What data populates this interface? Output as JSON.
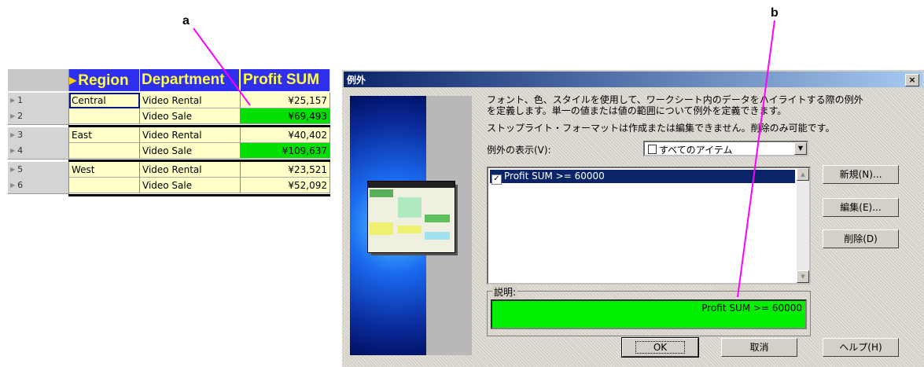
{
  "callouts": {
    "a": "a",
    "b": "b"
  },
  "grid": {
    "headers": [
      "Region",
      "Department",
      "Profit SUM"
    ],
    "rows": [
      {
        "num": "1",
        "region": "Central",
        "department": "Video Rental",
        "profit": "¥25,157",
        "highlight": false
      },
      {
        "num": "2",
        "region": "",
        "department": "Video Sale",
        "profit": "¥69,493",
        "highlight": true
      },
      {
        "num": "3",
        "region": "East",
        "department": "Video Rental",
        "profit": "¥40,402",
        "highlight": false
      },
      {
        "num": "4",
        "region": "",
        "department": "Video Sale",
        "profit": "¥109,637",
        "highlight": true
      },
      {
        "num": "5",
        "region": "West",
        "department": "Video Rental",
        "profit": "¥23,521",
        "highlight": false
      },
      {
        "num": "6",
        "region": "",
        "department": "Video Sale",
        "profit": "¥52,092",
        "highlight": false
      }
    ]
  },
  "dialog": {
    "title": "例外",
    "close_label": "×",
    "description_line1": "フォント、色、スタイルを使用して、ワークシート内のデータをハイライトする際の例外",
    "description_line2": "を定義します。単一の値または値の範囲について例外を定義できます。",
    "description_line3": "ストップライト・フォーマットは作成または編集できません。削除のみ可能です。",
    "show_label": "例外の表示(V):",
    "show_value": "すべてのアイテム",
    "list_items": [
      "Profit SUM  >= 60000"
    ],
    "explanation_label": "説明:",
    "explanation_text": "Profit SUM  >= 60000",
    "buttons": {
      "new": "新規(N)...",
      "edit": "編集(E)...",
      "delete": "削除(D)",
      "ok": "OK",
      "cancel": "取消",
      "help": "ヘルプ(H)"
    }
  },
  "colors": {
    "highlight": "#00e000",
    "header_bg": "#2f2ff0",
    "header_text": "#ffff40",
    "cell_bg": "#ffffc8",
    "title_bar": "#0a246a"
  },
  "icons": {
    "expand": "triangle-right-icon",
    "dropdown": "chevron-down-icon",
    "doc": "document-icon"
  }
}
